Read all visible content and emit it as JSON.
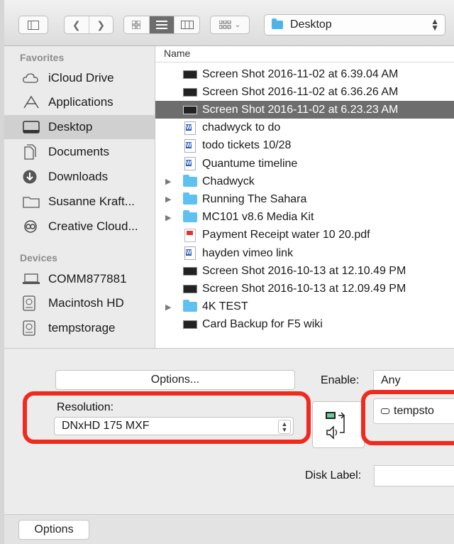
{
  "toolbar": {
    "path_label": "Desktop"
  },
  "sidebar": {
    "favorites_heading": "Favorites",
    "devices_heading": "Devices",
    "favorites": [
      {
        "label": "iCloud Drive",
        "icon": "cloud-icon"
      },
      {
        "label": "Applications",
        "icon": "applications-icon"
      },
      {
        "label": "Desktop",
        "icon": "desktop-icon",
        "selected": true
      },
      {
        "label": "Documents",
        "icon": "documents-icon"
      },
      {
        "label": "Downloads",
        "icon": "downloads-icon"
      },
      {
        "label": "Susanne Kraft...",
        "icon": "folder-icon"
      },
      {
        "label": "Creative Cloud...",
        "icon": "creative-cloud-icon"
      }
    ],
    "devices": [
      {
        "label": "COMM877881",
        "icon": "laptop-icon"
      },
      {
        "label": "Macintosh HD",
        "icon": "disk-icon"
      },
      {
        "label": "tempstorage",
        "icon": "disk-icon"
      }
    ]
  },
  "filelist": {
    "column_name": "Name",
    "rows": [
      {
        "name": "Screen Shot 2016-11-02 at 6.39.04 AM",
        "type": "screenshot"
      },
      {
        "name": "Screen Shot 2016-11-02 at 6.36.26 AM",
        "type": "screenshot"
      },
      {
        "name": "Screen Shot 2016-11-02 at 6.23.23 AM",
        "type": "screenshot",
        "selected": true
      },
      {
        "name": "chadwyck to do",
        "type": "word"
      },
      {
        "name": "todo tickets 10/28",
        "type": "word"
      },
      {
        "name": "Quantume timeline",
        "type": "word"
      },
      {
        "name": "Chadwyck",
        "type": "folder"
      },
      {
        "name": "Running The Sahara",
        "type": "folder"
      },
      {
        "name": "MC101 v8.6 Media Kit",
        "type": "folder"
      },
      {
        "name": "Payment Receipt water 10 20.pdf",
        "type": "pdf"
      },
      {
        "name": "hayden vimeo link",
        "type": "word"
      },
      {
        "name": "Screen Shot 2016-10-13 at 12.10.49 PM",
        "type": "screenshot"
      },
      {
        "name": "Screen Shot 2016-10-13 at 12.09.49 PM",
        "type": "screenshot"
      },
      {
        "name": "4K TEST",
        "type": "folder"
      },
      {
        "name": "Card Backup for F5 wiki",
        "type": "screenshot"
      }
    ]
  },
  "panel": {
    "options_label": "Options...",
    "enable_label": "Enable:",
    "enable_value": "Any",
    "resolution_label": "Resolution:",
    "resolution_value": "DNxHD 175  MXF",
    "destination_value": "tempsto",
    "disk_label_label": "Disk Label:",
    "disk_label_value": ""
  },
  "footer": {
    "options_label": "Options"
  },
  "colors": {
    "highlight_red": "#f02a1f",
    "selection_gray": "#6d6d6d",
    "folder_blue": "#5ec1f2"
  }
}
